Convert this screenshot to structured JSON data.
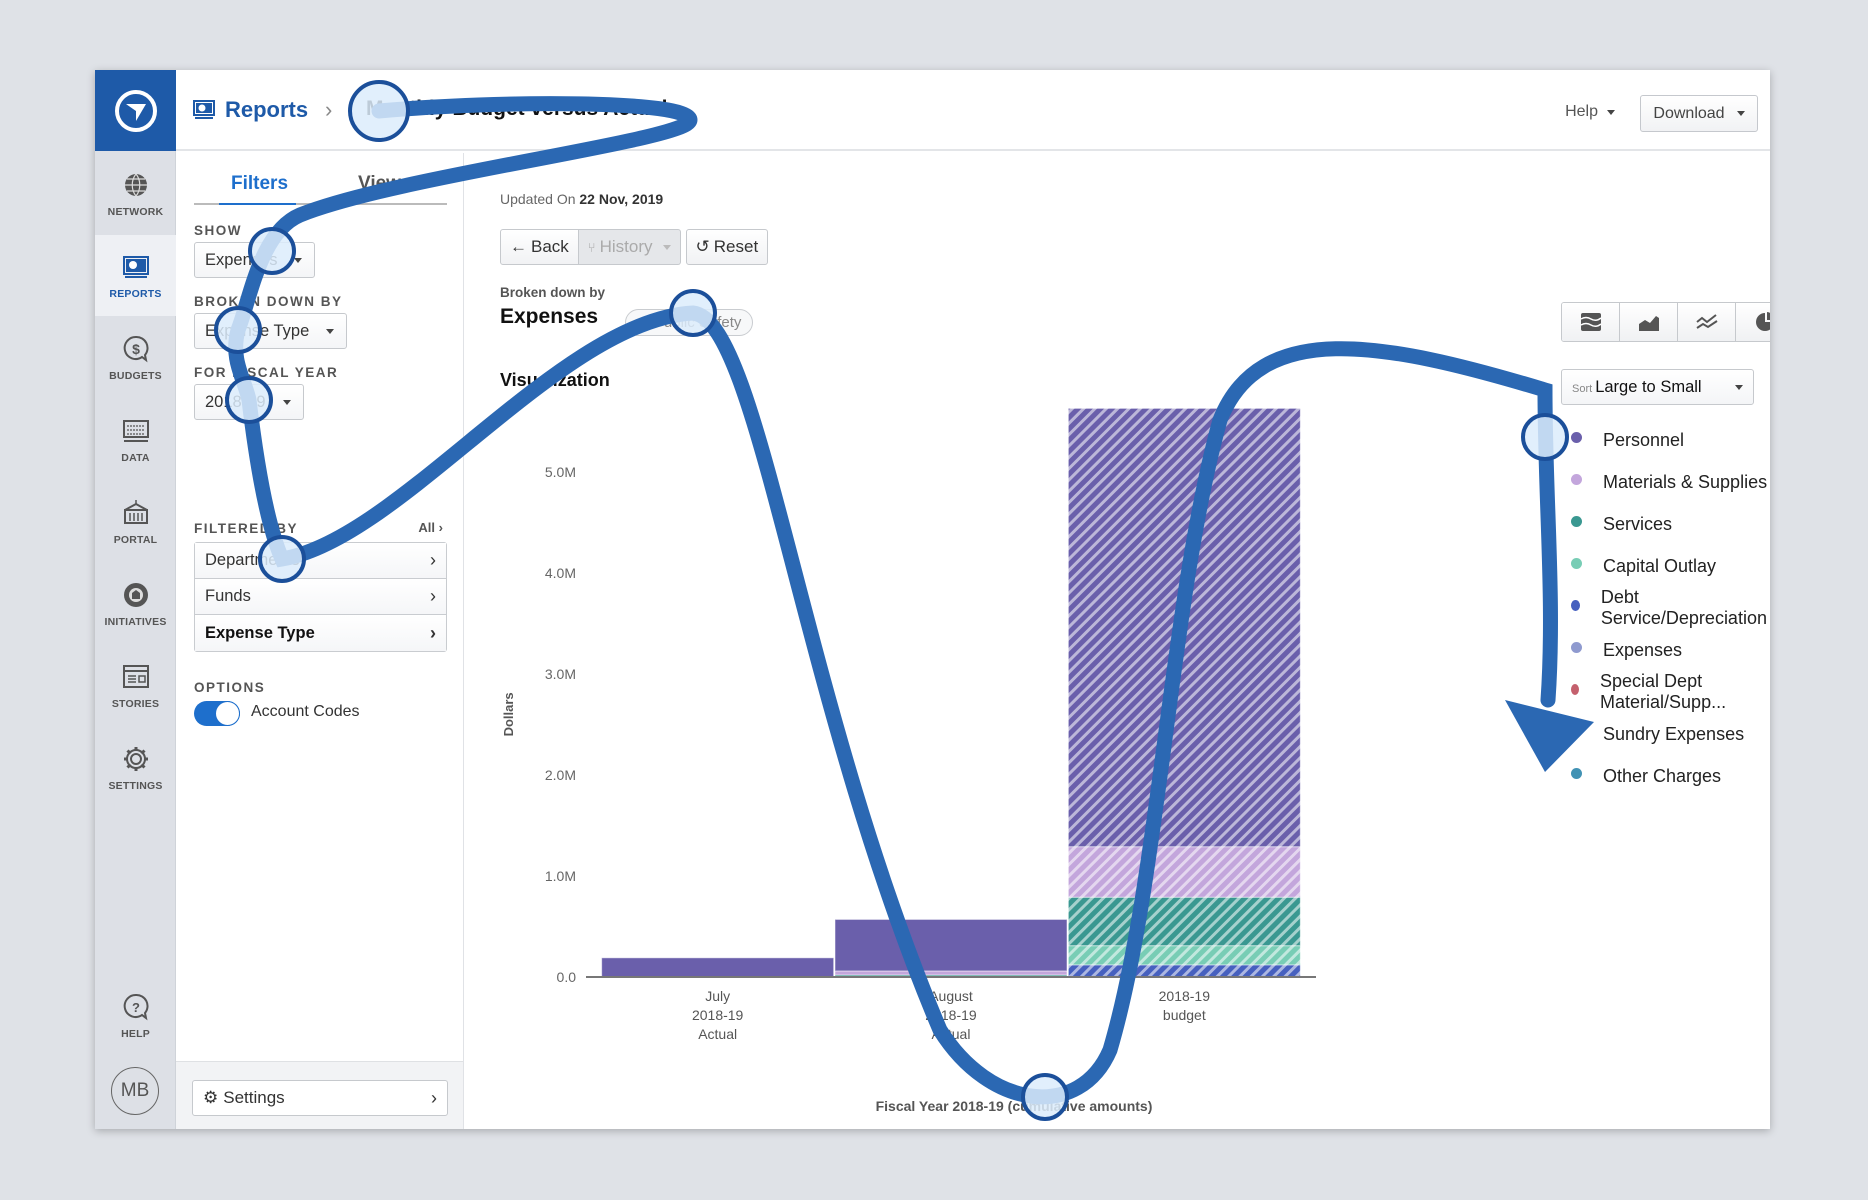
{
  "header": {
    "breadcrumb_root": "Reports",
    "breadcrumb_sep": "›",
    "title": "Monthly Budget versus Actual",
    "help_label": "Help",
    "download_label": "Download"
  },
  "nav": {
    "items": [
      {
        "label": "NETWORK",
        "icon": "globe-icon"
      },
      {
        "label": "REPORTS",
        "icon": "reports-icon",
        "active": true
      },
      {
        "label": "BUDGETS",
        "icon": "dollar-bubble-icon"
      },
      {
        "label": "DATA",
        "icon": "data-table-icon"
      },
      {
        "label": "PORTAL",
        "icon": "building-icon"
      },
      {
        "label": "INITIATIVES",
        "icon": "initiatives-icon"
      },
      {
        "label": "STORIES",
        "icon": "stories-icon"
      },
      {
        "label": "SETTINGS",
        "icon": "gear-icon"
      }
    ],
    "help_label": "HELP",
    "avatar_initials": "MB"
  },
  "panel": {
    "tabs": [
      "Filters",
      "Views"
    ],
    "show_label": "SHOW",
    "show_value": "Expenses",
    "broken_label": "BROKEN DOWN BY",
    "broken_value": "Expense Type",
    "fiscal_label": "FOR FISCAL YEAR",
    "fiscal_value": "2018-19",
    "filtered_label": "FILTERED BY",
    "all_label": "All",
    "filters": [
      "Departments",
      "Funds",
      "Expense Type"
    ],
    "options_label": "OPTIONS",
    "account_codes_label": "Account Codes",
    "account_codes_on": true,
    "settings_label": "Settings"
  },
  "main": {
    "updated_prefix": "Updated On",
    "updated_date": "22 Nov, 2019",
    "back_label": "Back",
    "history_label": "History",
    "reset_label": "Reset",
    "broken_down_by_label": "Broken down by",
    "broken_down_by_value": "Expenses",
    "filter_pill": "Public Safety",
    "viz_title": "Visualization",
    "chart_types": [
      "stacked-area-icon",
      "area-icon",
      "line-icon",
      "pie-icon",
      "bar-icon"
    ],
    "active_chart_type": "bar-icon",
    "sort_prefix": "Sort",
    "sort_value": "Large to Small"
  },
  "chart_data": {
    "type": "bar",
    "stacked": true,
    "title": "Visualization",
    "xlabel": "Fiscal Year 2018-19 (cumulative amounts)",
    "ylabel": "Dollars",
    "ylim": [
      0,
      5.8
    ],
    "yunit": "M",
    "yticks": [
      "0.0",
      "1.0M",
      "2.0M",
      "3.0M",
      "4.0M",
      "5.0M"
    ],
    "ytick_values": [
      0,
      1,
      2,
      3,
      4,
      5
    ],
    "categories": [
      [
        "July",
        "2018-19",
        "Actual"
      ],
      [
        "August",
        "2018-19",
        "Actual"
      ],
      [
        "2018-19",
        "budget"
      ]
    ],
    "hatched_categories": [
      false,
      false,
      true
    ],
    "legend_placement": "right",
    "series": [
      {
        "name": "Personnel",
        "color": "#6a5fab",
        "values": [
          0.19,
          0.51,
          4.34
        ]
      },
      {
        "name": "Materials & Supplies",
        "color": "#c3a6dc",
        "values": [
          0.0,
          0.04,
          0.5
        ]
      },
      {
        "name": "Services",
        "color": "#3a9891",
        "values": [
          0.0,
          0.02,
          0.48
        ]
      },
      {
        "name": "Capital Outlay",
        "color": "#78cdb5",
        "values": [
          0.0,
          0.0,
          0.19
        ]
      },
      {
        "name": "Debt Service/Depreciation",
        "color": "#4660bf",
        "values": [
          0.0,
          0.0,
          0.12
        ]
      },
      {
        "name": "Expenses",
        "color": "#8f9acf",
        "values": [
          0,
          0,
          0
        ]
      },
      {
        "name": "Special Dept Material/Supp...",
        "color": "#c4606d",
        "values": [
          0,
          0,
          0
        ]
      },
      {
        "name": "Sundry Expenses",
        "color": "#e4a0a3",
        "values": [
          0,
          0,
          0
        ]
      },
      {
        "name": "Other Charges",
        "color": "#4192b4",
        "values": [
          0,
          0,
          0
        ]
      }
    ]
  },
  "colors": {
    "brand": "#1e5aa8",
    "accent": "#1e6fcc",
    "annotation": "#2b68b3"
  }
}
